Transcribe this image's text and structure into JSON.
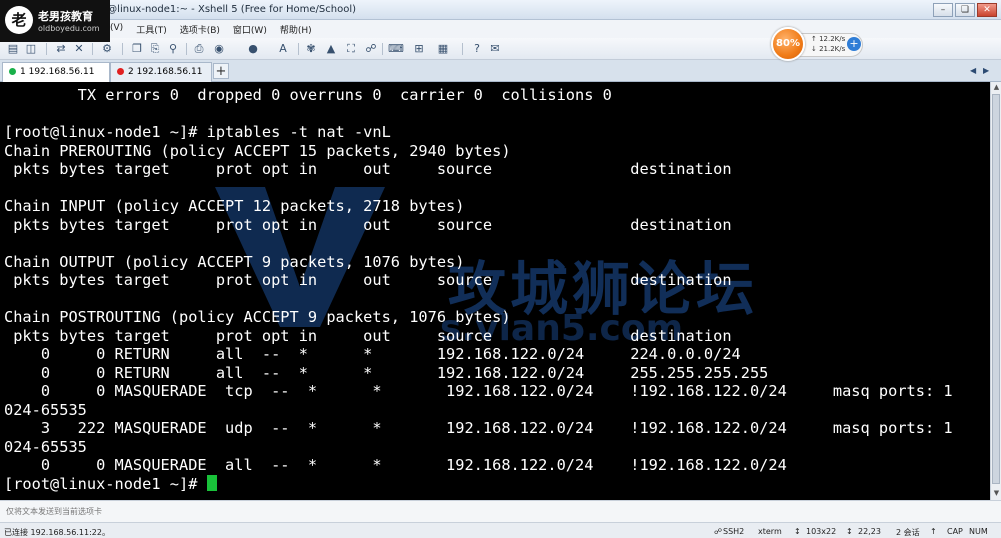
{
  "window": {
    "title": " @linux-node1:~ - Xshell 5 (Free for Home/School)",
    "buttons": [
      "–",
      "❏",
      "✕"
    ]
  },
  "logo": {
    "name": "老男孩教育",
    "url": "oldboyedu.com"
  },
  "menu": [
    "(V)",
    "工具(T)",
    "选项卡(B)",
    "窗口(W)",
    "帮助(H)"
  ],
  "monitor": {
    "percent": "80%",
    "upload": "12.2K/s",
    "download": "21.2K/s"
  },
  "tabs": [
    {
      "label": "1 192.168.56.11",
      "status_color": "#19b04a"
    },
    {
      "label": "2 192.168.56.11",
      "status_color": "#e02020"
    }
  ],
  "terminal": {
    "lines": [
      "        TX errors 0  dropped 0 overruns 0  carrier 0  collisions 0",
      "",
      "[root@linux-node1 ~]# iptables -t nat -vnL",
      "Chain PREROUTING (policy ACCEPT 15 packets, 2940 bytes)",
      " pkts bytes target     prot opt in     out     source               destination",
      "",
      "Chain INPUT (policy ACCEPT 12 packets, 2718 bytes)",
      " pkts bytes target     prot opt in     out     source               destination",
      "",
      "Chain OUTPUT (policy ACCEPT 9 packets, 1076 bytes)",
      " pkts bytes target     prot opt in     out     source               destination",
      "",
      "Chain POSTROUTING (policy ACCEPT 9 packets, 1076 bytes)",
      " pkts bytes target     prot opt in     out     source               destination",
      "    0     0 RETURN     all  --  *      *       192.168.122.0/24     224.0.0.0/24",
      "    0     0 RETURN     all  --  *      *       192.168.122.0/24     255.255.255.255",
      "    0     0 MASQUERADE  tcp  --  *      *       192.168.122.0/24    !192.168.122.0/24     masq ports: 1",
      "024-65535",
      "    3   222 MASQUERADE  udp  --  *      *       192.168.122.0/24    !192.168.122.0/24     masq ports: 1",
      "024-65535",
      "    0     0 MASQUERADE  all  --  *      *       192.168.122.0/24    !192.168.122.0/24"
    ],
    "prompt": "[root@linux-node1 ~]# ",
    "watermark_text": "攻城狮论坛",
    "watermark_url": "s.vlan5.com"
  },
  "input_bar": {
    "placeholder": "仅将文本发送到当前选项卡"
  },
  "status": {
    "connection": "已连接 192.168.56.11:22。",
    "protocol": "SSH2",
    "terminal_type": "xterm",
    "size": "103x22",
    "position": "22,23",
    "sessions": "2 会话",
    "caps": "CAP",
    "num": "NUM"
  }
}
